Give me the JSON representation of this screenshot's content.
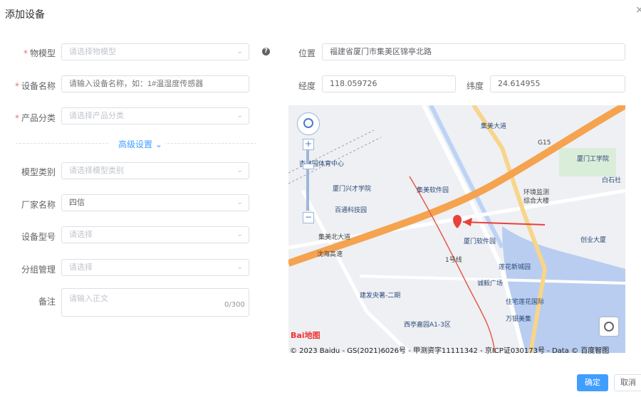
{
  "dialog": {
    "title": "添加设备",
    "close_glyph": "×"
  },
  "form": {
    "thing_model": {
      "label": "物模型",
      "placeholder": "请选择物模型"
    },
    "device_name": {
      "label": "设备名称",
      "placeholder": "请输入设备名称，如：1#温湿度传感器"
    },
    "product_category": {
      "label": "产品分类",
      "placeholder": "请选择产品分类"
    },
    "advanced": {
      "label": "高级设置"
    },
    "model_type": {
      "label": "模型类别",
      "placeholder": "请选择模型类别"
    },
    "manufacturer": {
      "label": "厂家名称",
      "value": "四信"
    },
    "device_model": {
      "label": "设备型号",
      "placeholder": "请选择"
    },
    "group": {
      "label": "分组管理",
      "placeholder": "请选择"
    },
    "remark": {
      "label": "备注",
      "placeholder": "请输入正文",
      "count": "0/300"
    },
    "location": {
      "label": "位置",
      "value": "福建省厦门市集美区锦亭北路"
    },
    "longitude": {
      "label": "经度",
      "value": "118.059726"
    },
    "latitude": {
      "label": "纬度",
      "value": "24.614955"
    }
  },
  "map": {
    "labels": {
      "jimei_avenue": "集美大道",
      "xmut": "厦门工学院",
      "baishi": "白石社",
      "sports_center": "杏林园体育中心",
      "xingcai": "厦门兴才学院",
      "software_park_station": "集美软件园",
      "env_monitor_1": "环境监测",
      "env_monitor_2": "综合大楼",
      "baitong": "百通科技园",
      "jimei_north": "集美北大道",
      "software_park": "厦门软件园",
      "chuangye": "创业大厦",
      "shenhai": "沈海高速",
      "line1": "1号线",
      "lianhua_new_city": "莲花新城园",
      "chengyi": "诚毅广场",
      "jianfa": "建发央著-二期",
      "zhuzhai": "住宅莲花国际",
      "xiting": "西亭嘉园A1-3区",
      "wanyin": "万银美集",
      "g15": "G15",
      "logo_text": "Bai地图",
      "copyright": "© 2023 Baidu - GS(2021)6026号 - 甲测资字11111342 - 京ICP证030173号 - Data © 百度智图"
    }
  },
  "actions": {
    "confirm": "确定",
    "cancel": "取消"
  },
  "colors": {
    "primary": "#409eff",
    "required": "#f56c6c",
    "marker": "#e8413b"
  }
}
